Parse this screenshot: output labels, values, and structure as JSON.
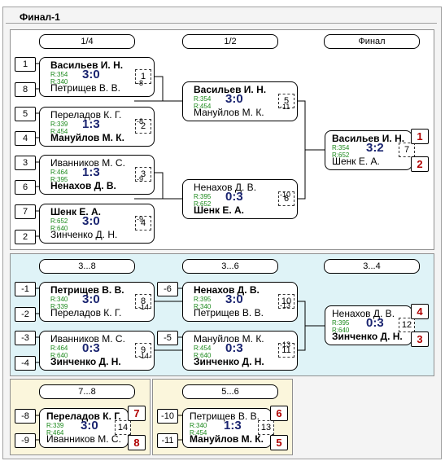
{
  "title": "Финал-1",
  "headers": {
    "q14": "1/4",
    "q12": "1/2",
    "fin": "Финал",
    "p38": "3...8",
    "p36": "3...6",
    "p34": "3...4",
    "p78": "7...8",
    "p56": "5...6"
  },
  "seeds": {
    "s1": "1",
    "s8": "8",
    "s5": "5",
    "s4": "4",
    "s3": "3",
    "s6": "6",
    "s7": "7",
    "s2": "2",
    "m1": "-1",
    "m2": "-2",
    "m3": "-3",
    "m4": "-4",
    "m6": "-6",
    "m5": "-5",
    "m8": "-8",
    "m9": "-9",
    "m10": "-10",
    "m11": "-11"
  },
  "matches": {
    "m1": {
      "p1": "Васильев И. Н.",
      "r1": "R:354",
      "p2": "Петрищев В. В.",
      "r2": "R:340",
      "score": "3:0",
      "num": "1",
      "flow": "-8"
    },
    "m2": {
      "p1": "Переладов К. Г.",
      "r1": "R:339",
      "p2": "Мануйлов М. К.",
      "r2": "R:454",
      "score": "1:3",
      "num": "2",
      "flow": "-8"
    },
    "m3": {
      "p1": "Иванников М. С.",
      "r1": "R:464",
      "p2": "Ненахов Д. В.",
      "r2": "R:395",
      "score": "1:3",
      "num": "3",
      "flow": "-9"
    },
    "m4": {
      "p1": "Шенк Е. А.",
      "r1": "R:652",
      "p2": "Зинченко Д. Н.",
      "r2": "R:640",
      "score": "3:0",
      "num": "4",
      "flow": "-9"
    },
    "m5": {
      "p1": "Васильев И. Н.",
      "r1": "R:354",
      "p2": "Мануйлов М. К.",
      "r2": "R:454",
      "score": "3:0",
      "num": "5",
      "flow": "-11"
    },
    "m6": {
      "p1": "Ненахов Д. В.",
      "r1": "R:395",
      "p2": "Шенк Е. А.",
      "r2": "R:652",
      "score": "0:3",
      "num": "6",
      "flow": "-10"
    },
    "m7": {
      "p1": "Васильев И. Н.",
      "r1": "R:354",
      "p2": "Шенк Е. А.",
      "r2": "R:652",
      "score": "3:2",
      "num": "7",
      "rank1": "1",
      "rank2": "2"
    },
    "m8": {
      "p1": "Петрищев В. В.",
      "r1": "R:340",
      "p2": "Переладов К. Г.",
      "r2": "R:339",
      "score": "3:0",
      "num": "8",
      "flow": "-14"
    },
    "m9": {
      "p1": "Иванников М. С.",
      "r1": "R:464",
      "p2": "Зинченко Д. Н.",
      "r2": "R:640",
      "score": "0:3",
      "num": "9",
      "flow": "-14"
    },
    "m10": {
      "p1": "Ненахов Д. В.",
      "r1": "R:395",
      "p2": "Петрищев В. В.",
      "r2": "R:340",
      "score": "3:0",
      "num": "10",
      "flow": "-13"
    },
    "m11": {
      "p1": "Мануйлов М. К.",
      "r1": "R:454",
      "p2": "Зинченко Д. Н.",
      "r2": "R:640",
      "score": "0:3",
      "num": "11",
      "flow": "-13"
    },
    "m12": {
      "p1": "Ненахов Д. В.",
      "r1": "R:395",
      "p2": "Зинченко Д. Н.",
      "r2": "R:640",
      "score": "0:3",
      "num": "12",
      "rank1": "4",
      "rank2": "3"
    },
    "m14": {
      "p1": "Переладов К. Г.",
      "r1": "R:339",
      "p2": "Иванников М. С.",
      "r2": "R:464",
      "score": "3:0",
      "num": "14",
      "rank1": "7",
      "rank2": "8"
    },
    "m13": {
      "p1": "Петрищев В. В.",
      "r1": "R:340",
      "p2": "Мануйлов М. К.",
      "r2": "R:454",
      "score": "1:3",
      "num": "13",
      "rank1": "6",
      "rank2": "5"
    }
  }
}
